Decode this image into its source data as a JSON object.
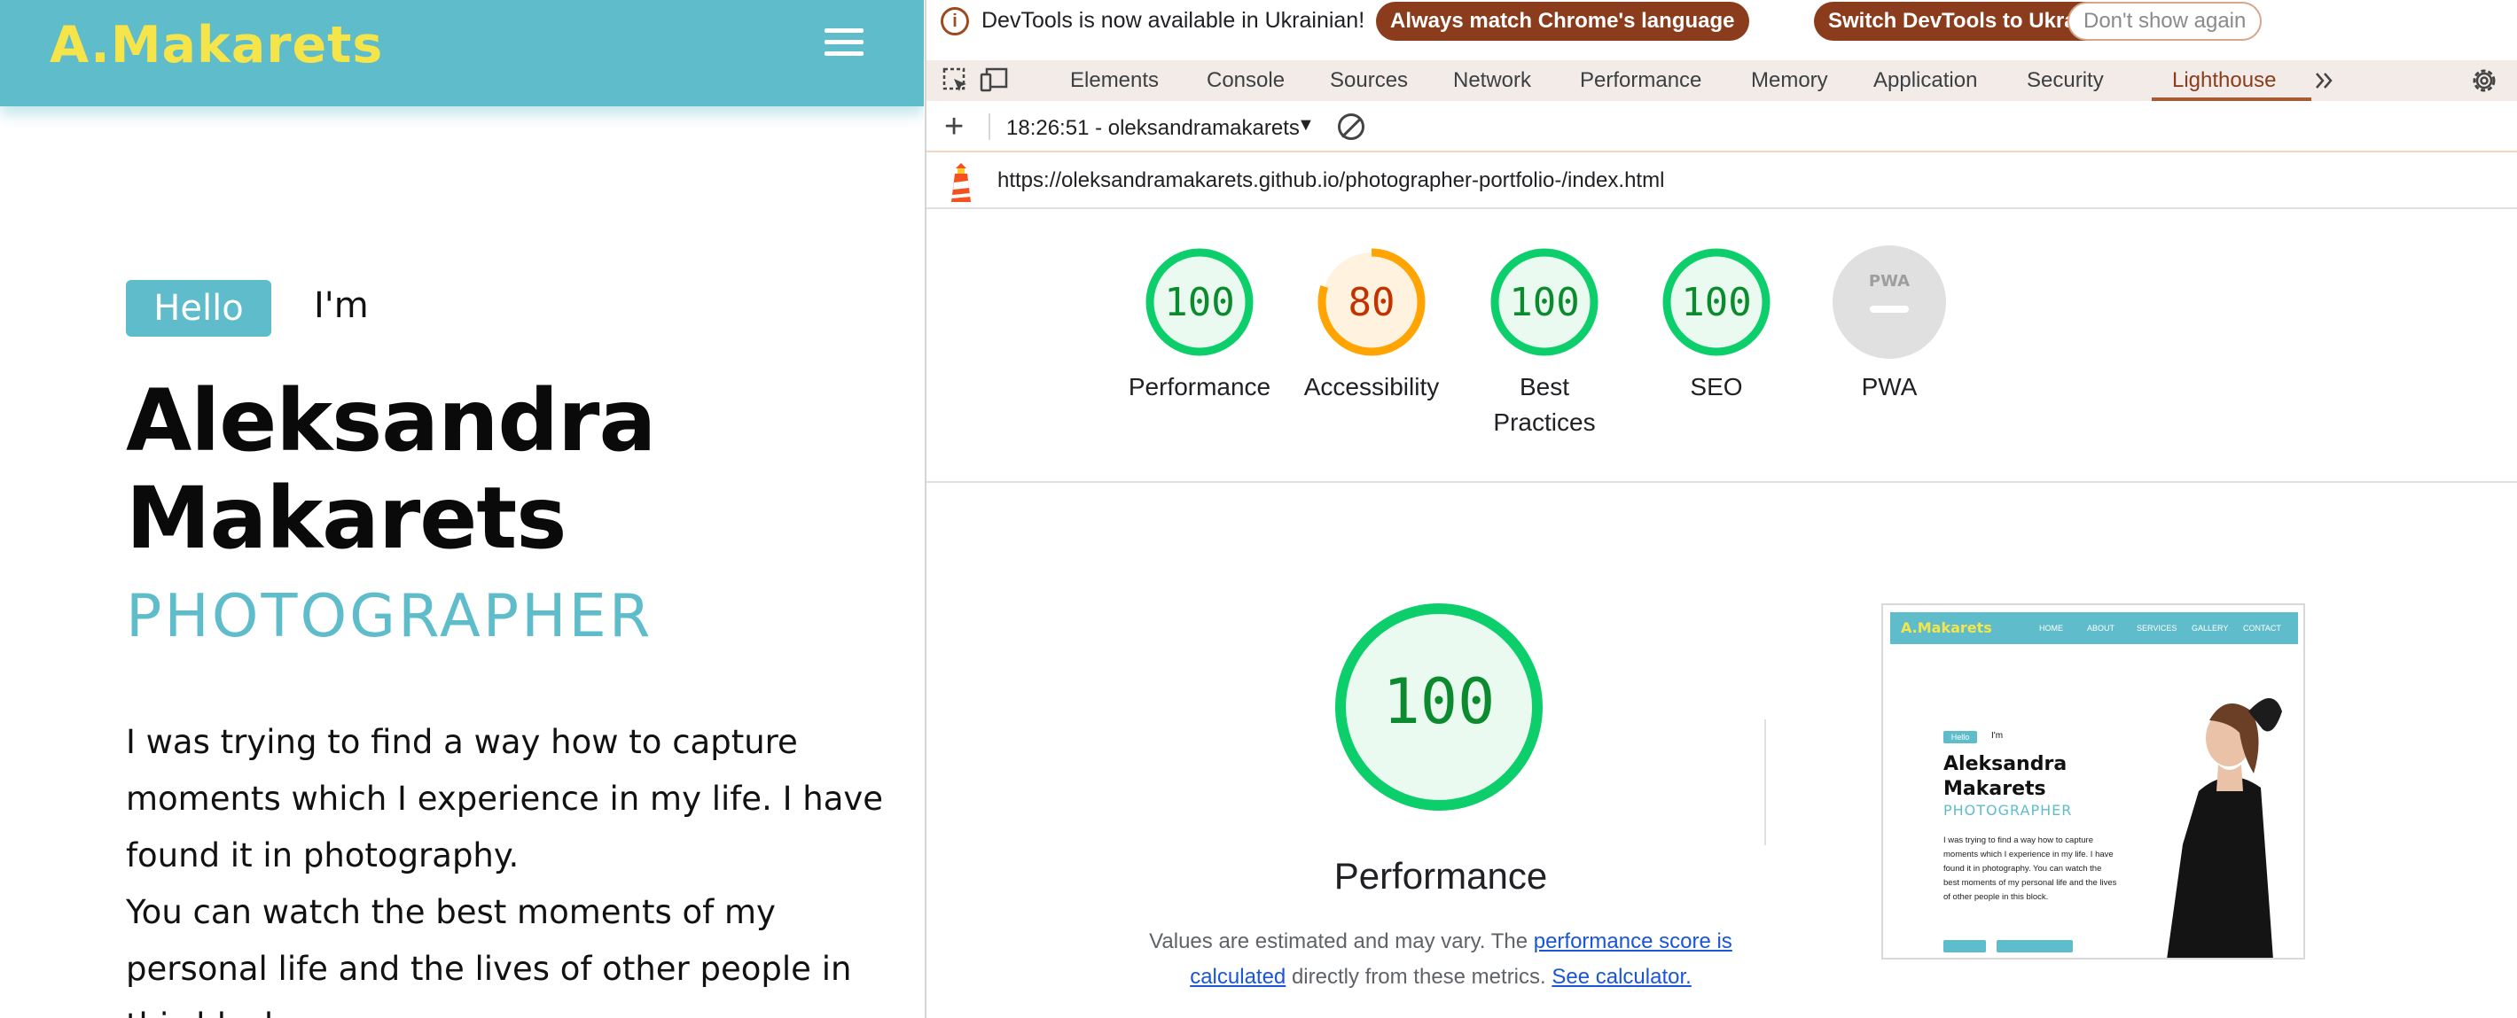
{
  "site": {
    "logo": "A.Makarets",
    "hello_badge": "Hello",
    "im": "I'm",
    "name_line1": "Aleksandra",
    "name_line2": "Makarets",
    "role": "PHOTOGRAPHER",
    "text_line1": "I was trying to find a way how to capture",
    "text_line2": "moments which I experience in my life. I have",
    "text_line3": "found it in photography.",
    "text_line4": "You can watch the best moments of my",
    "text_line5": "personal life and the lives of other people in",
    "text_line6": "this block."
  },
  "devtools": {
    "infobar": {
      "message": "DevTools is now available in Ukrainian!",
      "btn_match": "Always match Chrome's language",
      "btn_switch": "Switch DevTools to Ukrainian",
      "btn_dismiss": "Don't show again"
    },
    "tabs": [
      "Elements",
      "Console",
      "Sources",
      "Network",
      "Performance",
      "Memory",
      "Application",
      "Security",
      "Lighthouse"
    ],
    "active_tab": "Lighthouse",
    "more_tabs_icon": "chevron-double-right-icon",
    "report_select": "18:26:51 - oleksandramakarets",
    "url": "https://oleksandramakarets.github.io/photographer-portfolio-/index.html",
    "gauges": [
      {
        "label": "Performance",
        "score": "100",
        "value": 100,
        "color": "#0cce6b"
      },
      {
        "label": "Accessibility",
        "score": "80",
        "value": 80,
        "color": "#ffa400"
      },
      {
        "label": "Best Practices",
        "score": "100",
        "value": 100,
        "color": "#0cce6b"
      },
      {
        "label": "SEO",
        "score": "100",
        "value": 100,
        "color": "#0cce6b"
      },
      {
        "label": "PWA",
        "score": "",
        "value": null,
        "color": "#cccccc"
      }
    ],
    "pwa_badge_text": "PWA",
    "performance": {
      "score": "100",
      "title": "Performance",
      "note_prefix": "Values are estimated and may vary. The ",
      "note_link1": "performance score is calculated",
      "note_mid": " directly from these metrics. ",
      "note_link2": "See calculator."
    },
    "thumbnail": {
      "logo": "A.Makarets",
      "nav": [
        "HOME",
        "ABOUT",
        "SERVICES",
        "GALLERY",
        "CONTACT"
      ],
      "hello": "Hello",
      "im": "I'm",
      "name_line1": "Aleksandra",
      "name_line2": "Makarets",
      "role": "PHOTOGRAPHER",
      "text": "I was trying to find a way how to capture moments which I experience in my life. I have found it in photography. You can watch the best moments of my personal life and the lives of other people in this block."
    }
  },
  "colors": {
    "accent": "#5fbdcb",
    "logo": "#f5e44a",
    "devtools_brand": "#8b3c1c",
    "pass": "#0cce6b",
    "average": "#ffa400"
  }
}
